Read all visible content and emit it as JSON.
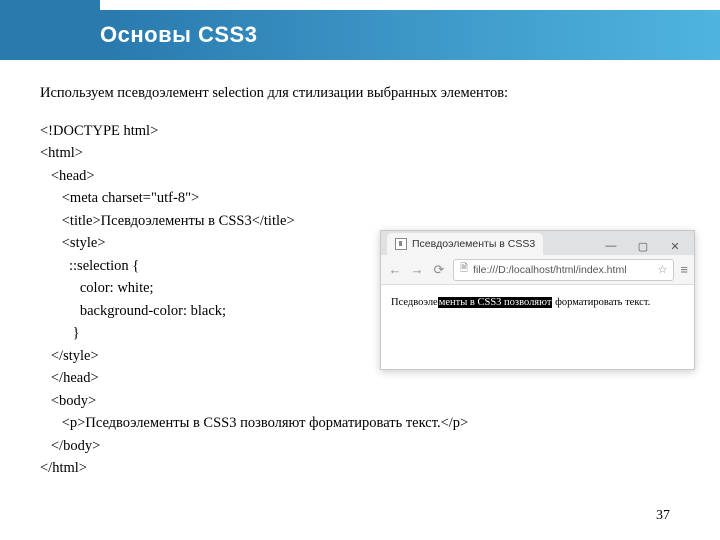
{
  "header": {
    "title": "Основы CSS3"
  },
  "intro": "Используем псевдоэлемент selection для стилизации выбранных элементов:",
  "code": {
    "l1": "<!DOCTYPE html>",
    "l2": "<html>",
    "l3": "   <head>",
    "l4": "      <meta charset=\"utf-8\">",
    "l5": "      <title>Псевдоэлементы в CSS3</title>",
    "l6": "      <style>",
    "l7": "        ::selection {",
    "l8": "           color: white;",
    "l9": "           background-color: black;",
    "l10": "         }",
    "l11": "   </style>",
    "l12": "   </head>",
    "l13": "   <body>",
    "l14": "      <p>Пседвоэлементы в CSS3 позволяют форматировать текст.</p>",
    "l15": "   </body>",
    "l16": "</html>"
  },
  "browser": {
    "tabTitle": "Псевдоэлементы в CSS3",
    "url": "file:///D:/localhost/html/index.html",
    "bodyPrefix": "Пседвоэле",
    "bodySelected": "менты в CSS3 позволяют",
    "bodySuffix": " форматировать текст."
  },
  "win": {
    "min": "—",
    "max": "▢",
    "close": "✕"
  },
  "nav": {
    "back": "←",
    "fwd": "→",
    "reload": "⟳"
  },
  "addr": {
    "fileIcon": "🗎",
    "star": "☆",
    "menu": "≡"
  },
  "pageNum": "37"
}
